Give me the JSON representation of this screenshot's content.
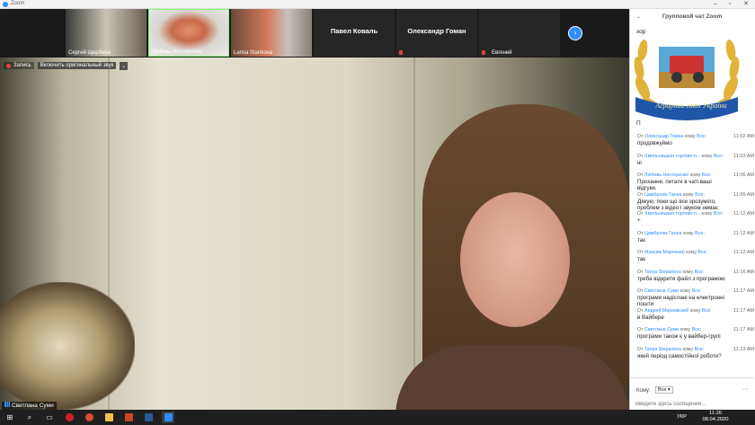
{
  "window": {
    "title": "Zoom"
  },
  "participants": [
    {
      "name": "Сергей Щербина",
      "video": true,
      "muted": false
    },
    {
      "name": "Любовь Нестеренко",
      "video": true,
      "muted": false
    },
    {
      "name": "Larisa Starikova",
      "video": true,
      "muted": false
    },
    {
      "name": "Павел Коваль",
      "video": false,
      "muted": false
    },
    {
      "name": "Олександр Гоман",
      "video": false,
      "muted": true
    },
    {
      "name": "Евгений",
      "video": false,
      "muted": true
    }
  ],
  "main_video": {
    "recording_label": "Запись",
    "original_sound_button": "Включить оригинальный звук",
    "dropdown": "⌄",
    "active_speaker": "Светлана Суми"
  },
  "chat": {
    "title": "Групповой чат Zoom",
    "logo_text": "Аграрний союз України",
    "partial_top": "хор",
    "partial_sender_row": "П",
    "from_prefix": "От",
    "to_word": "кому",
    "messages": [
      {
        "from": "Олександр Гоман",
        "to": "Все",
        "time": "11:02 AM",
        "text": "продовжуймо"
      },
      {
        "from": "Хмельницкая торгово-п...",
        "to": "Все",
        "time": "11:03 AM",
        "text": "ні"
      },
      {
        "from": "Любовь Нестеренко",
        "to": "Все",
        "time": "11:06 AM",
        "text": "Прохання, питати в чаті  ваші відгуки."
      },
      {
        "from": "Цимбалюк Ганна",
        "to": "Все",
        "time": "11:09 AM",
        "text": "Дякую, поки що все зрозуміло, проблем з відео і звуком немає"
      },
      {
        "from": "Хмельницкая торгово-п...",
        "to": "Все",
        "time": "11:12 AM",
        "text": "+"
      },
      {
        "from": "Цимбалюк Ганна",
        "to": "Все",
        "time": "11:12 AM",
        "text": "так"
      },
      {
        "from": "Максим Марченко",
        "to": "Все",
        "time": "11:12 AM",
        "text": "так"
      },
      {
        "from": "Tanya Stepanova",
        "to": "Все",
        "time": "11:16 AM",
        "text": "треба відкрити файл з програмою"
      },
      {
        "from": "Светлана Суми",
        "to": "Все",
        "time": "11:17 AM",
        "text": "програми надіслані на електронні пошти"
      },
      {
        "from": "Андрей Мирковский",
        "to": "Все",
        "time": "11:17 AM",
        "text": "в Вайбере"
      },
      {
        "from": "Светлана Суми",
        "to": "Все",
        "time": "11:17 AM",
        "text": "програми також є у вайбер-групі"
      },
      {
        "from": "Tanya Stepanova",
        "to": "Все",
        "time": "11:23 AM",
        "text": "який період самостійної роботи?"
      }
    ],
    "to_label": "Кому:",
    "to_value": "Все",
    "more": "···",
    "input_placeholder": "Введите здесь сообщения..."
  },
  "taskbar": {
    "language": "УКР",
    "time": "11:26",
    "date": "08.04.2020"
  }
}
